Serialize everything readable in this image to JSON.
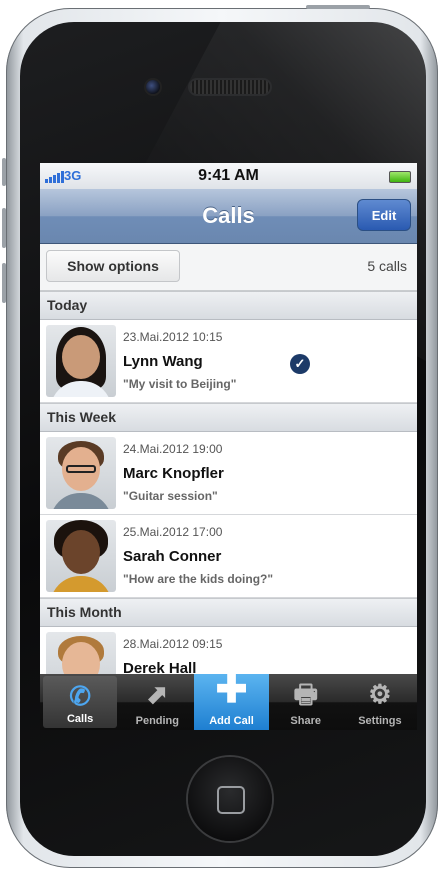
{
  "status_bar": {
    "carrier": "3G",
    "time": "9:41 AM"
  },
  "nav": {
    "title": "Calls",
    "edit_label": "Edit"
  },
  "toolbar": {
    "show_options_label": "Show options",
    "call_count": "5 calls"
  },
  "sections": [
    {
      "title": "Today",
      "calls": [
        {
          "date": "23.Mai.2012 10:15",
          "name": "Lynn Wang",
          "subject": "\"My visit to Beijing\"",
          "checked": true
        }
      ]
    },
    {
      "title": "This Week",
      "calls": [
        {
          "date": "24.Mai.2012 19:00",
          "name": "Marc Knopfler",
          "subject": "\"Guitar session\""
        },
        {
          "date": "25.Mai.2012 17:00",
          "name": "Sarah Conner",
          "subject": "\"How are the kids doing?\""
        }
      ]
    },
    {
      "title": "This Month",
      "calls": [
        {
          "date": "28.Mai.2012 09:15",
          "name": "Derek Hall",
          "subject": ""
        }
      ]
    }
  ],
  "tabs": [
    {
      "label": "Calls",
      "icon": "phone-icon"
    },
    {
      "label": "Pending",
      "icon": "pending-arrow-icon"
    },
    {
      "label": "Add Call",
      "icon": "plus-icon"
    },
    {
      "label": "Share",
      "icon": "printer-icon"
    },
    {
      "label": "Settings",
      "icon": "gear-icon"
    }
  ],
  "colors": {
    "nav_bar": "#7f98bd",
    "accent_blue": "#2a5ab1",
    "add_call_tab": "#1e7fd1"
  }
}
